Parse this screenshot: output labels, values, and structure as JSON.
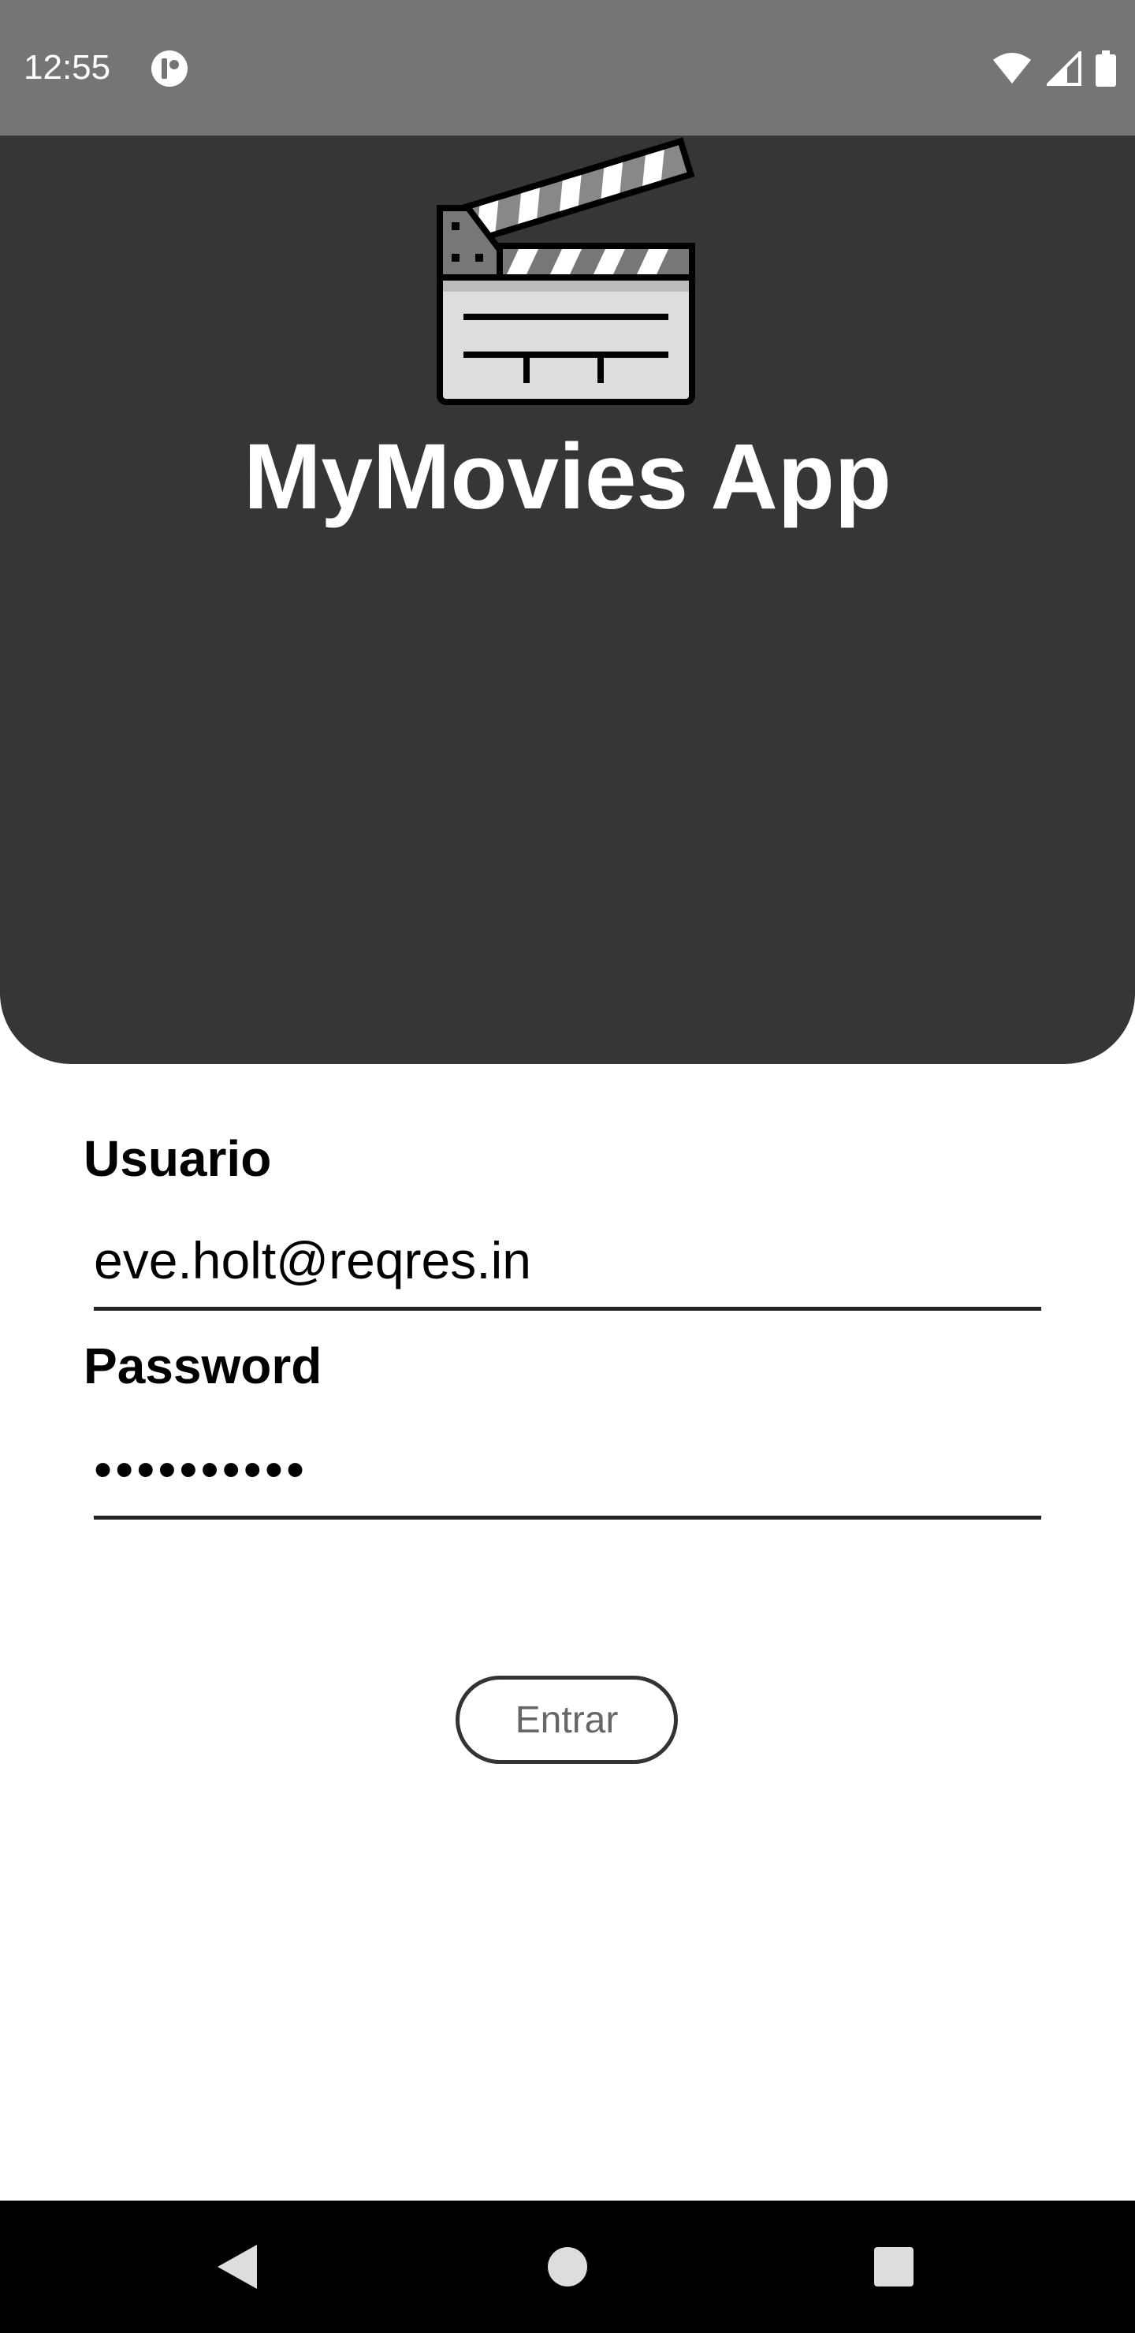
{
  "status_bar": {
    "time": "12:55",
    "icons": [
      "app-notification-icon",
      "wifi-icon",
      "cell-signal-icon",
      "battery-icon"
    ]
  },
  "header": {
    "logo_icon": "clapperboard-icon",
    "title": "MyMovies App"
  },
  "form": {
    "username": {
      "label": "Usuario",
      "value": "eve.holt@reqres.in"
    },
    "password": {
      "label": "Password",
      "value": "••••••••••"
    },
    "submit_label": "Entrar"
  },
  "nav_bar": {
    "icons": [
      "back-icon",
      "home-icon",
      "recents-icon"
    ]
  },
  "colors": {
    "status_bar": "#757575",
    "header": "#363636",
    "nav_bar": "#000000",
    "text_primary": "#000000",
    "button_text": "#666666"
  }
}
